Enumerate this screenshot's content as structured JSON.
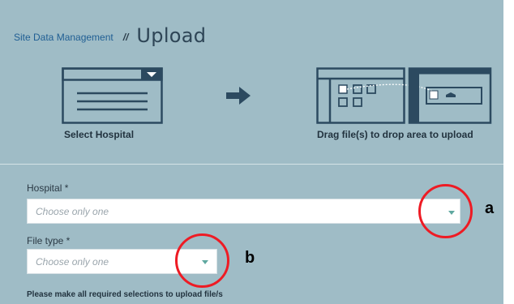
{
  "breadcrumb": {
    "link": "Site Data Management",
    "separator": "//",
    "title": "Upload"
  },
  "steps": [
    {
      "label": "Select Hospital",
      "icon": "dropdown-list-icon"
    },
    {
      "icon": "arrow-right-icon"
    },
    {
      "label": "Drag file(s) to drop area to upload",
      "icon": "drag-drop-icon"
    }
  ],
  "form": {
    "hospital": {
      "label": "Hospital *",
      "placeholder": "Choose only one"
    },
    "file_type": {
      "label": "File type *",
      "placeholder": "Choose only one"
    },
    "note": "Please make all required selections to upload file/s"
  },
  "annotations": [
    {
      "label": "a",
      "color": "#ee1b24"
    },
    {
      "label": "b",
      "color": "#ee1b24"
    }
  ],
  "colors": {
    "panel": "#9fbcc6",
    "link": "#1f5e93",
    "icon_stroke": "#2c4a60",
    "caret": "#5fa8a0"
  }
}
